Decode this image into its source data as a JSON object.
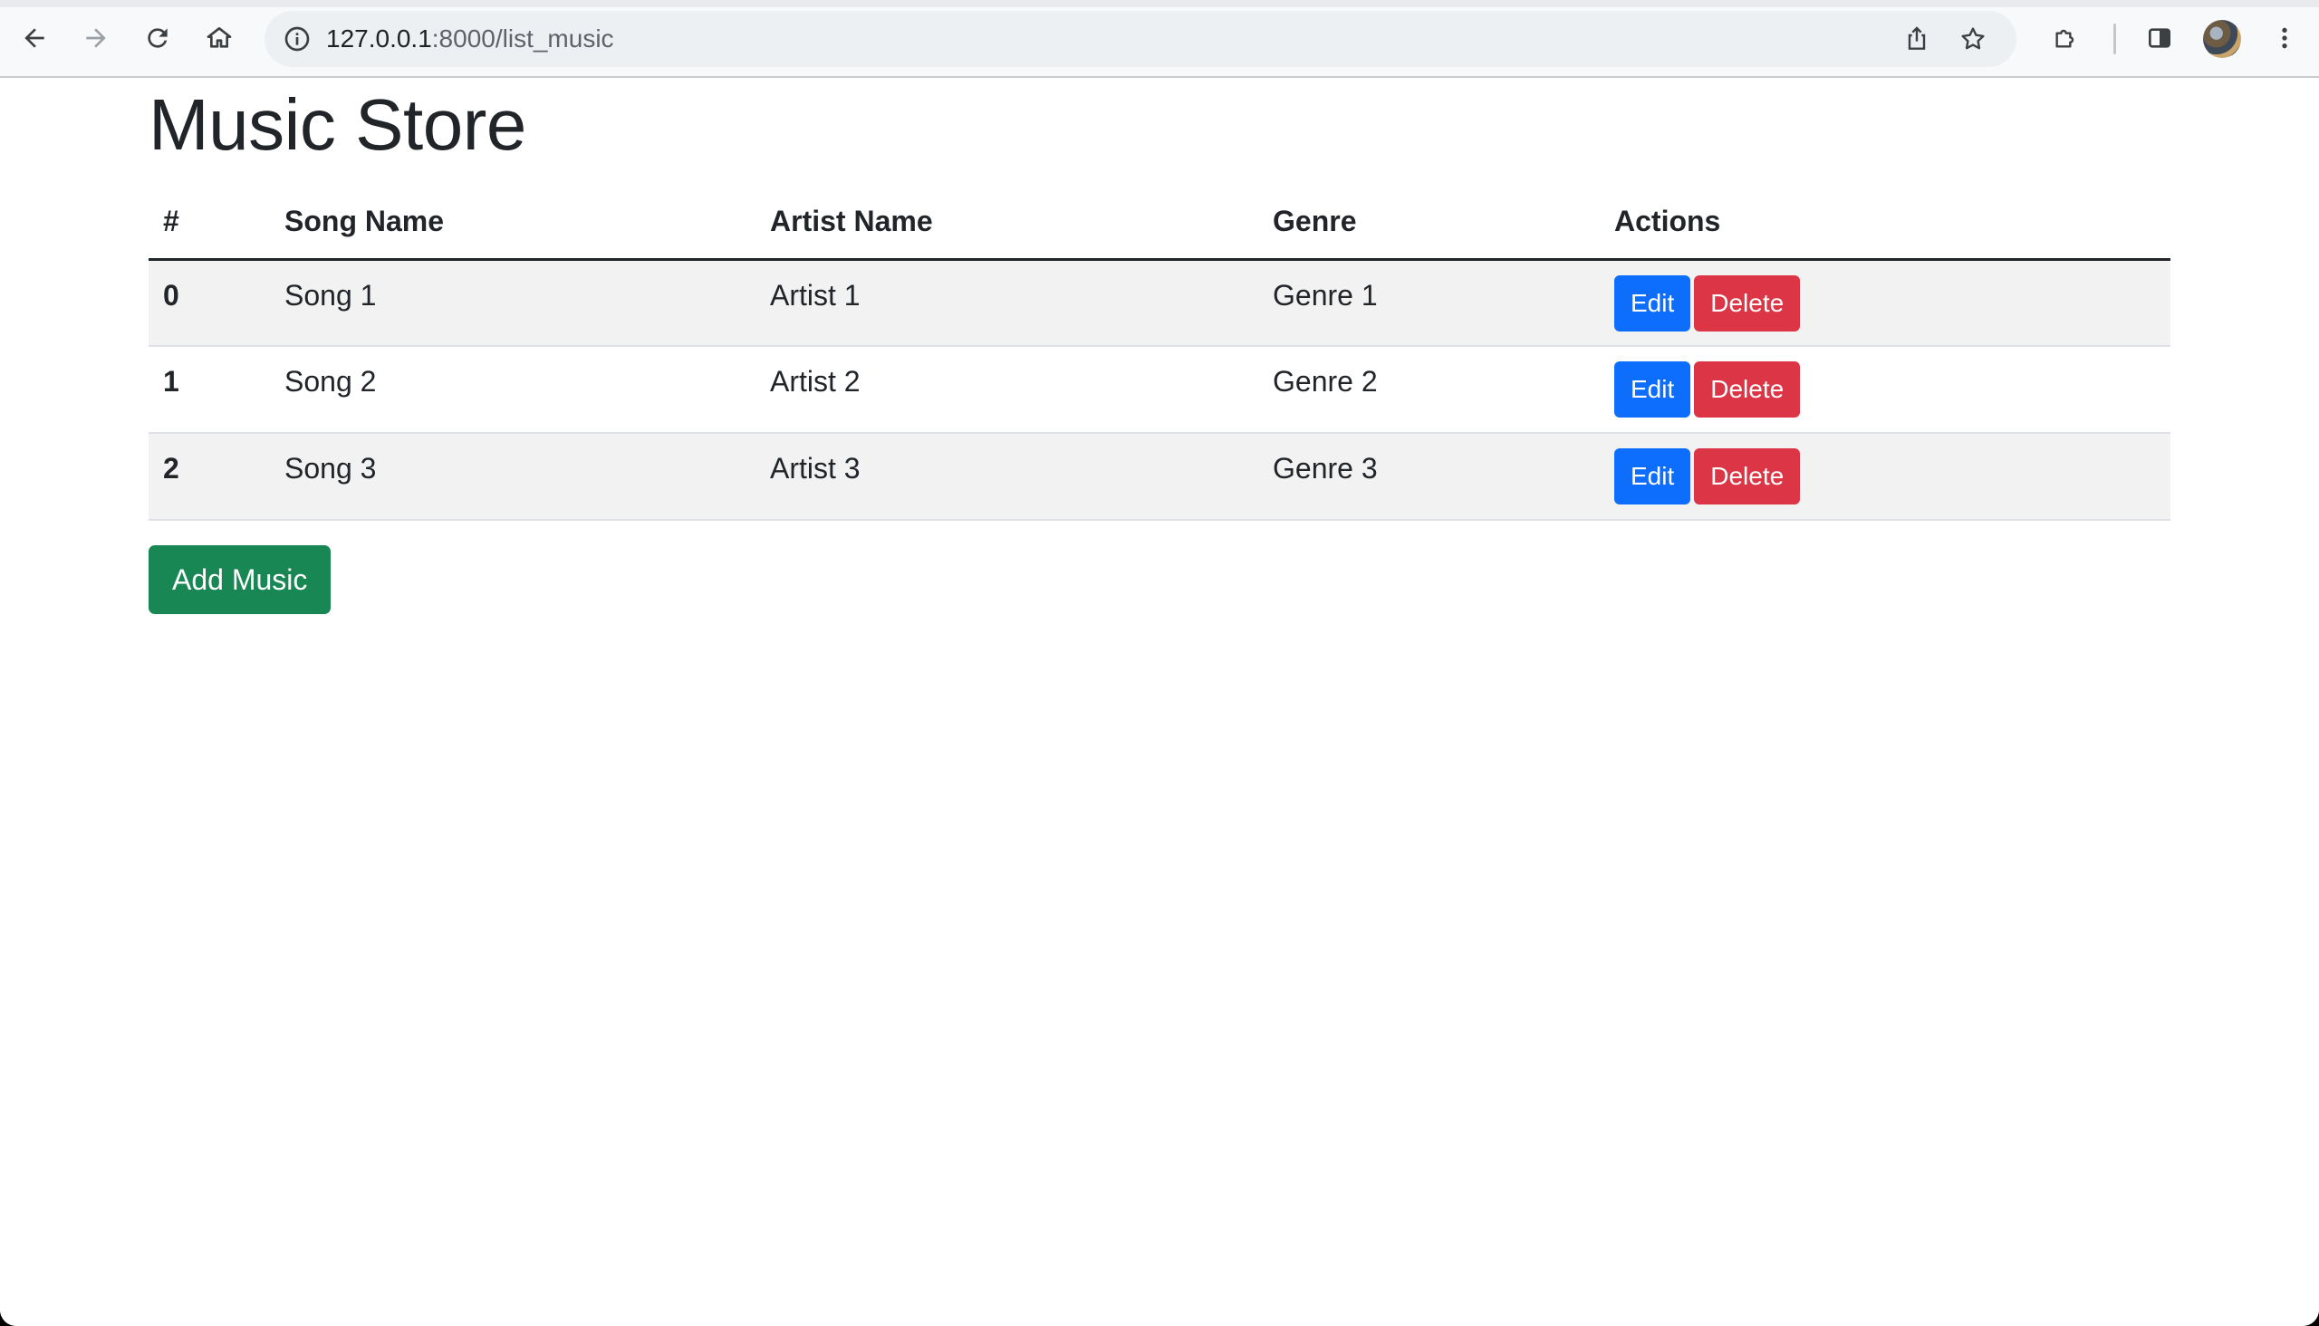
{
  "browser": {
    "url_host": "127.0.0.1",
    "url_path": ":8000/list_music",
    "icons": [
      "back-arrow-icon",
      "forward-arrow-icon",
      "reload-icon",
      "home-icon",
      "site-info-icon",
      "share-icon",
      "bookmark-star-icon",
      "extensions-puzzle-icon",
      "side-panel-icon",
      "profile-avatar",
      "kebab-menu-icon"
    ]
  },
  "page": {
    "title": "Music Store",
    "table": {
      "headers": {
        "index": "#",
        "song": "Song Name",
        "artist": "Artist Name",
        "genre": "Genre",
        "actions": "Actions"
      },
      "rows": [
        {
          "index": "0",
          "song": "Song 1",
          "artist": "Artist 1",
          "genre": "Genre 1",
          "edit": "Edit",
          "delete": "Delete"
        },
        {
          "index": "1",
          "song": "Song 2",
          "artist": "Artist 2",
          "genre": "Genre 2",
          "edit": "Edit",
          "delete": "Delete"
        },
        {
          "index": "2",
          "song": "Song 3",
          "artist": "Artist 3",
          "genre": "Genre 3",
          "edit": "Edit",
          "delete": "Delete"
        }
      ]
    },
    "add_button": "Add Music"
  },
  "colors": {
    "edit": "#0d6efd",
    "delete": "#dc3545",
    "add": "#198754",
    "stripe": "#f2f2f2",
    "text": "#212529"
  }
}
